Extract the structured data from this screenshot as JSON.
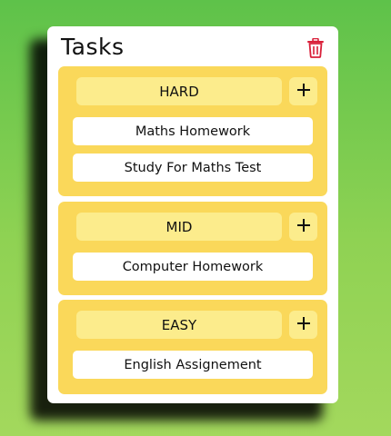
{
  "app": {
    "title": "Tasks"
  },
  "toolbar": {
    "delete_icon": "trash-icon",
    "delete_color": "#d9203a"
  },
  "colors": {
    "background_top": "#5ec24a",
    "background_bottom": "#a3d85d",
    "group_bg": "#fad85a",
    "header_bg": "#fcec8c",
    "task_bg": "#ffffff"
  },
  "groups": [
    {
      "label": "HARD",
      "add_icon": "plus-icon",
      "tasks": [
        "Maths Homework",
        "Study For Maths Test"
      ]
    },
    {
      "label": "MID",
      "add_icon": "plus-icon",
      "tasks": [
        "Computer Homework"
      ]
    },
    {
      "label": "EASY",
      "add_icon": "plus-icon",
      "tasks": [
        "English Assignement"
      ]
    }
  ]
}
